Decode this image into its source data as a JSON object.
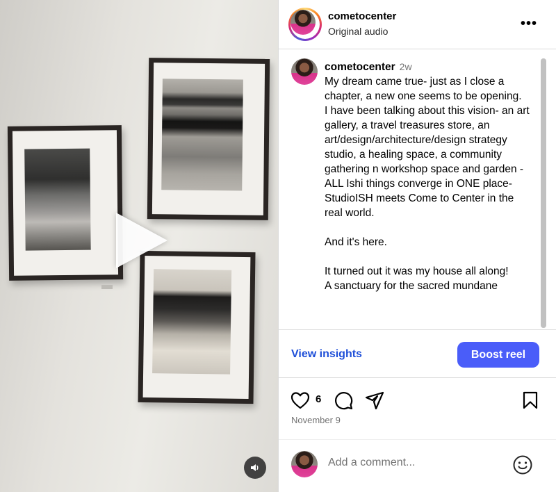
{
  "header": {
    "username": "cometocenter",
    "subtitle": "Original audio",
    "more": "•••"
  },
  "caption": {
    "username": "cometocenter",
    "age": "2w",
    "body": "My dream came true- just as I close a chapter, a new one seems to be opening.\nI have been talking about this vision- an art gallery, a travel treasures store, an art/design/architecture/design strategy studio, a healing space, a community gathering n workshop space and garden - ALL Ishi things converge in ONE place- StudioISH meets Come to Center in the real world.\n\nAnd it's here.\n\nIt turned out it was my house all along!\nA sanctuary for the sacred mundane"
  },
  "actions": {
    "insights_label": "View insights",
    "boost_label": "Boost reel"
  },
  "engagement": {
    "likes": "6",
    "date": "November 9"
  },
  "comment": {
    "placeholder": "Add a comment..."
  },
  "colors": {
    "boost_bg": "#4a5df9",
    "link": "#1d4ed8",
    "story_ring": [
      "#feda75",
      "#fa7e1e",
      "#d62976",
      "#962fbf",
      "#4f5bd5"
    ]
  },
  "icons": [
    "play-icon",
    "volume-icon",
    "more-icon",
    "heart-icon",
    "comment-icon",
    "share-icon",
    "bookmark-icon",
    "emoji-icon"
  ]
}
